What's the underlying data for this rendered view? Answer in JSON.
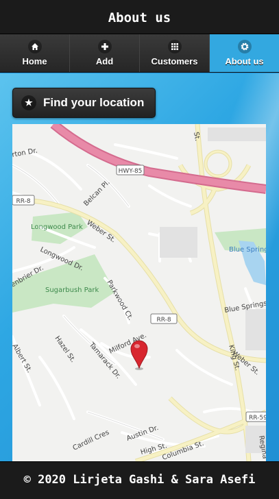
{
  "header": {
    "title": "About us"
  },
  "nav": {
    "items": [
      {
        "label": "Home",
        "icon": "home-icon",
        "active": false
      },
      {
        "label": "Add",
        "icon": "plus-icon",
        "active": false
      },
      {
        "label": "Customers",
        "icon": "grid-icon",
        "active": false
      },
      {
        "label": "About us",
        "icon": "gear-icon",
        "active": true
      }
    ]
  },
  "locate_button": {
    "label": "Find your location",
    "icon": "star-icon"
  },
  "map": {
    "labels": {
      "hwy85": "HWY-85",
      "rr8_left": "RR-8",
      "rr8_center": "RR-8",
      "rr59": "RR-59",
      "longwood_park": "Longwood Park",
      "sugarbush_park": "Sugarbush Park",
      "blue_spring": "Blue Spring",
      "blue_springs": "Blue Springs",
      "weber_st": "Weber St.",
      "weber_st_2": "Weber St.",
      "belcan_pl": "Belcan Pl.",
      "longwood_dr": "Longwood Dr.",
      "glenbrier_dr": "enbrier Dr.",
      "parkwood_ct": "Parkwood Ct.",
      "milford_ave": "Milford Ave.",
      "hazel_st": "Hazel St.",
      "tamarack_dr": "Tamarack Dr.",
      "albert_st": "Albert St.",
      "king_st": "King St.",
      "austin_dr": "Austin Dr.",
      "high_st": "High St.",
      "columbia_st": "Columbia St.",
      "cardill_cres": "Cardill Cres",
      "top_left": "rton Dr.",
      "top_st": "St.",
      "regina": "Regina"
    },
    "colors": {
      "highway": "#e88aa8",
      "major_road": "#f7f1c4",
      "park": "#c9e7c4",
      "water": "#a8d4f0",
      "marker": "#d8262f"
    }
  },
  "footer": {
    "text": "© 2020 Lirjeta Gashi & Sara Asefi"
  }
}
